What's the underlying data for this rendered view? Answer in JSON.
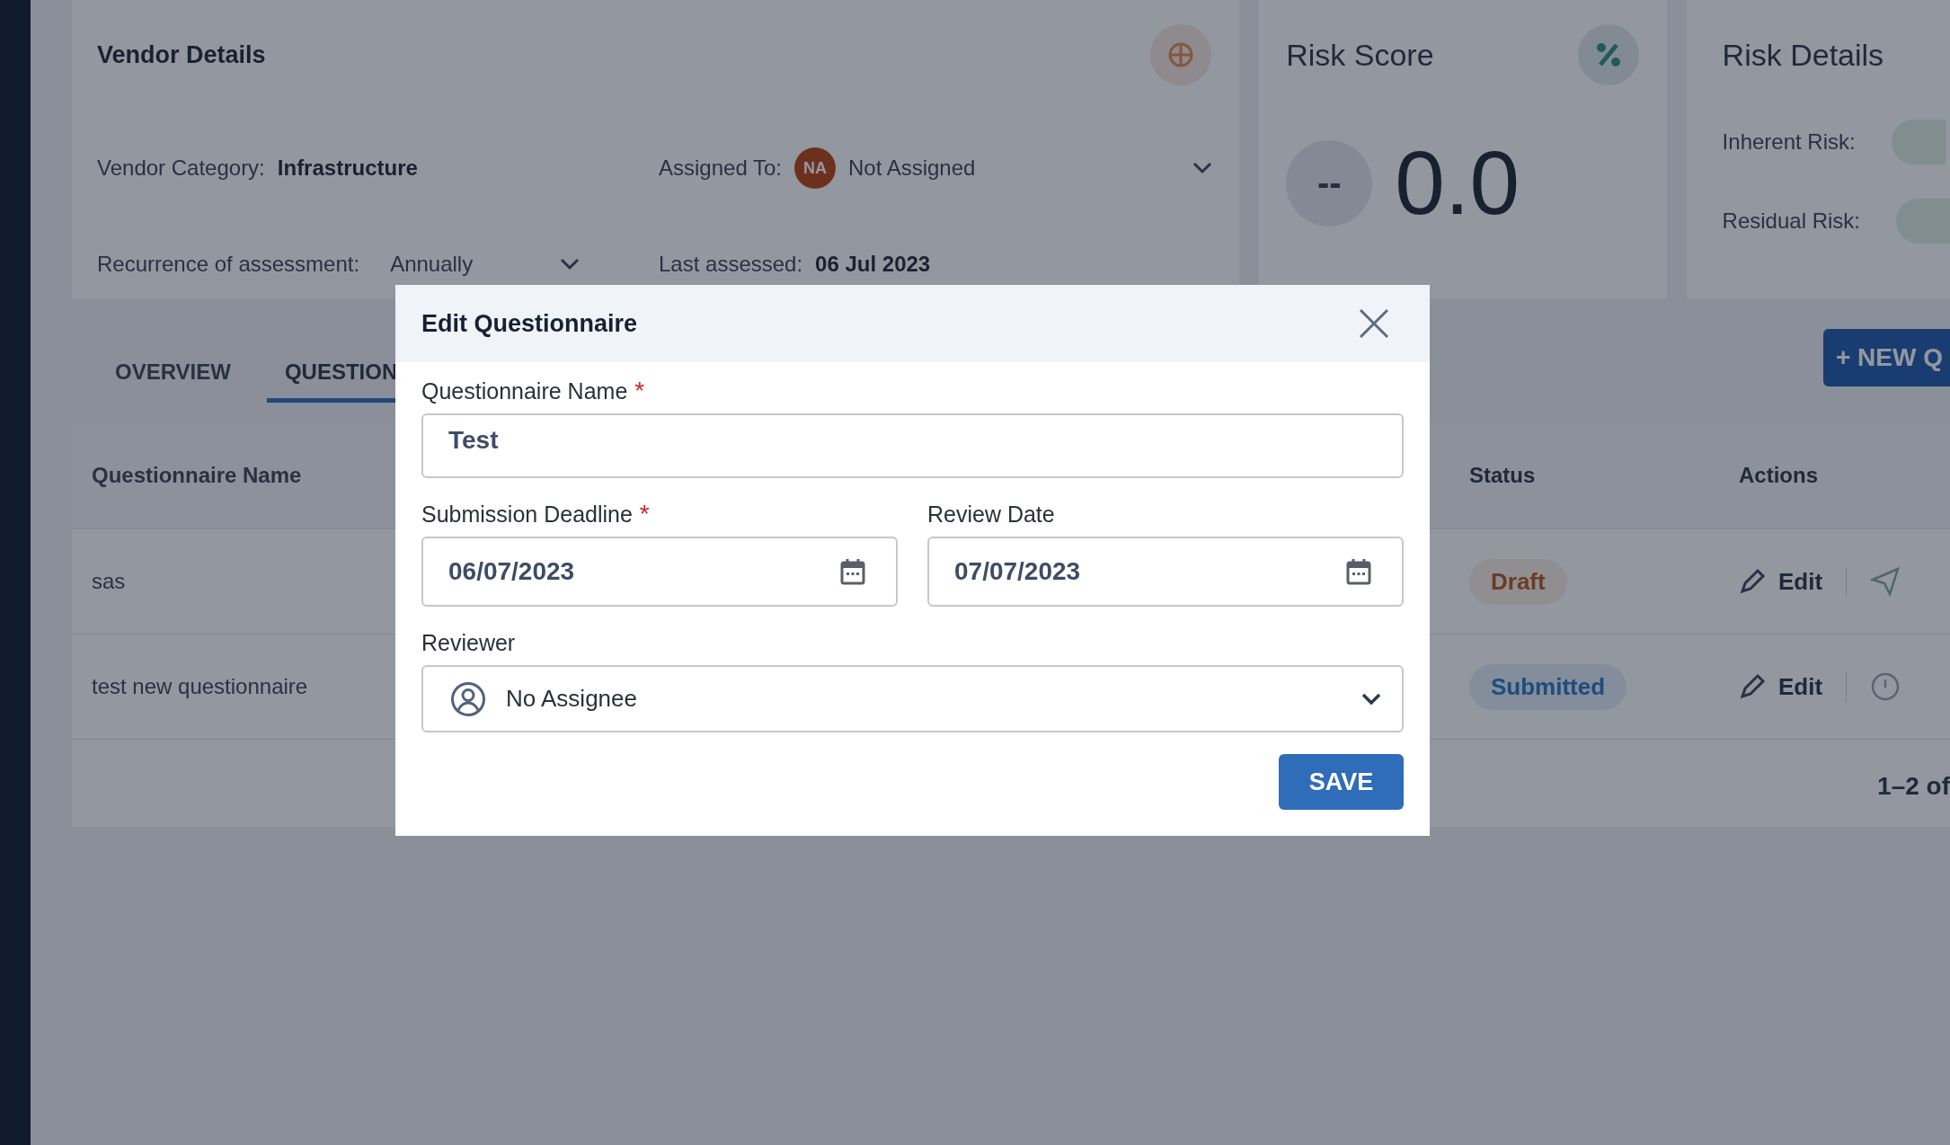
{
  "background": {
    "vendor_details": {
      "title": "Vendor Details",
      "category_label": "Vendor Category:",
      "category": "Infrastructure",
      "assigned_label": "Assigned To:",
      "assignee_initials": "NA",
      "assignee": "Not Assigned",
      "recurrence_label": "Recurrence of assessment:",
      "recurrence": "Annually",
      "last_assessed_label": "Last assessed:",
      "last_assessed": "06 Jul 2023"
    },
    "risk_score": {
      "title": "Risk Score",
      "badge": "--",
      "score": "0.0"
    },
    "risk_details": {
      "title": "Risk Details",
      "rows": [
        {
          "label": "Inherent Risk:"
        },
        {
          "label": "Residual Risk:"
        }
      ]
    },
    "tabs": [
      {
        "label": "OVERVIEW",
        "selected": false
      },
      {
        "label": "QUESTION",
        "selected": true
      }
    ],
    "new_button": "+ NEW Q",
    "table": {
      "columns": [
        "Questionnaire Name",
        "Status",
        "Actions"
      ],
      "rows": [
        {
          "name": "sas",
          "kind": "draft",
          "status": "Draft",
          "action": "Edit",
          "send": {
            "kind": "plane"
          }
        },
        {
          "name": "test new questionnaire",
          "kind": "submitted",
          "status": "Submitted",
          "action": "Edit",
          "send": {
            "kind": "clock"
          }
        }
      ],
      "pagination": "1–2 of"
    }
  },
  "modal": {
    "title": "Edit Questionnaire",
    "required_mark": "*",
    "fields": [
      {
        "label": "Questionnaire Name",
        "required": true,
        "value": "Test",
        "kind": "text"
      },
      {
        "label": "Submission Deadline",
        "required": true,
        "value": "06/07/2023",
        "kind": "date"
      },
      {
        "label": "Review Date",
        "required": false,
        "value": "07/07/2023",
        "kind": "date"
      },
      {
        "label": "Reviewer",
        "required": false,
        "value": "No Assignee",
        "kind": "select"
      }
    ],
    "save": "SAVE"
  }
}
